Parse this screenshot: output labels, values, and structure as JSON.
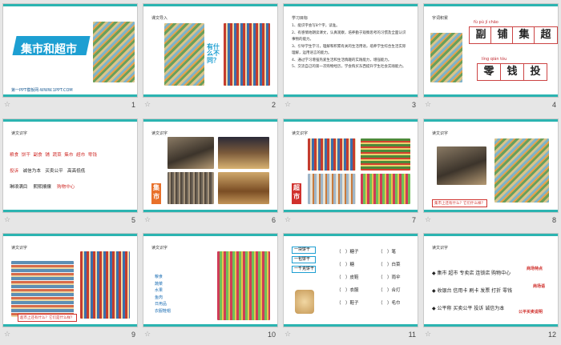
{
  "slides": [
    {
      "num": "1",
      "title": "集市和超市",
      "site": "第一PPT模板网-WWW.1PPT.COM"
    },
    {
      "num": "2",
      "label": "课文导入",
      "question": "有什么不同？"
    },
    {
      "num": "3",
      "label": "学习目标",
      "lines": [
        "1、能识字会写8个字，读准。",
        "2、有感情地朗读课文，认真观察，培养勤于观察思考的习惯及全面认识",
        "事物的能力。",
        "3、引导学生学习，理解和积累有关的生活用语，培养学生综合生活实际",
        "理解，运用语言的能力。",
        "4、通过学习增强热爱生活和生活情趣的实践能力，增强能力。",
        "5、交流自己的第一次购物经历，学会购买东西提升学生社会实践能力。"
      ]
    },
    {
      "num": "4",
      "label": "字词积累",
      "chars_row1": [
        "副",
        "铺",
        "集",
        "超"
      ],
      "pinyin_row1": "fù  pù  jí  chāo",
      "chars_row2": [
        "零",
        "钱",
        "投"
      ],
      "pinyin_row2": "líng qián tóu"
    },
    {
      "num": "5",
      "label": "读文识字",
      "row1": [
        "粮食",
        "饼干",
        "副食",
        "铺",
        "蔬菜",
        "集市",
        "超市",
        "零钱"
      ],
      "row2": [
        "投诉",
        "诚信为本",
        "买卖公平",
        "高高低低"
      ],
      "row3": [
        "琳琅满目",
        "熙熙攘攘",
        "购物中心"
      ]
    },
    {
      "num": "6",
      "label": "读文识字",
      "tag": "集市"
    },
    {
      "num": "7",
      "label": "读文识字",
      "tag": "超市"
    },
    {
      "num": "8",
      "label": "读文识字",
      "caption": "集市上还有什么？它们什么样？"
    },
    {
      "num": "9",
      "label": "读文识字",
      "caption": "超市上还有什么？它们是什么样？"
    },
    {
      "num": "10",
      "label": "读文识字",
      "col": [
        "粮食",
        "蔬菜",
        "水果",
        "鱼肉",
        "日用品",
        "衣服鞋帽"
      ]
    },
    {
      "num": "11",
      "label": "",
      "boxes": [
        "一块饼干",
        "一包饼干",
        "一千克饼干"
      ],
      "fill_left": [
        "（　）糖子",
        "（　）糖",
        "（　）皮鞋",
        "（　）衣服",
        "（　）鞋子"
      ],
      "fill_right": [
        "（　）笔",
        "（　）白菜",
        "（　）雨伞",
        "（　）合灯",
        "（　）毛巾"
      ]
    },
    {
      "num": "12",
      "label": "读文识字",
      "rows": [
        "◆ 集市  超市  专卖店  连锁店  购物中心",
        "◆ 收银台  信用卡  刷卡  发票  打折  零钱",
        "◆ 公平称  买卖公平  投诉  诚信为本"
      ],
      "notes": [
        "商场特点",
        "商场语",
        "公平买卖说明"
      ]
    }
  ]
}
